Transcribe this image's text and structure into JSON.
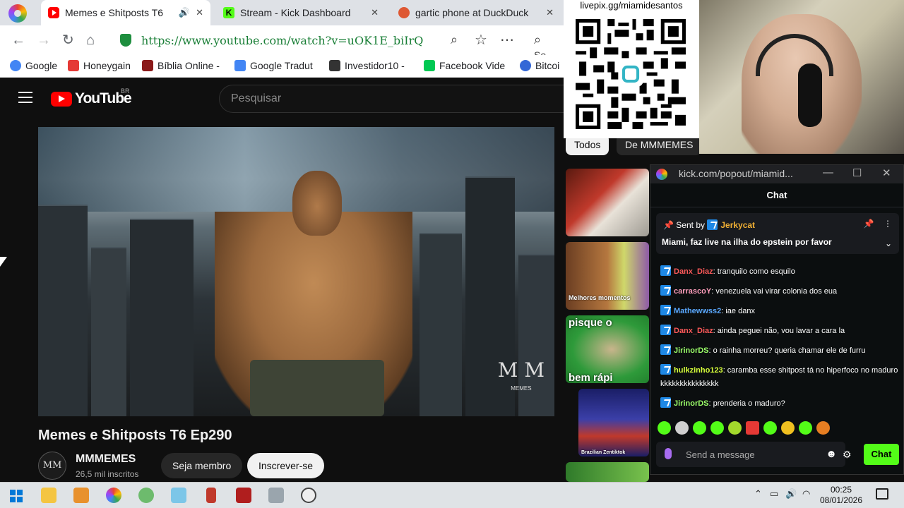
{
  "browser": {
    "tabs": [
      {
        "title": "Memes e Shitposts T6",
        "icon": "youtube-icon",
        "audio": true
      },
      {
        "title": "Stream - Kick Dashboard",
        "icon": "kick-icon"
      },
      {
        "title": "gartic phone at DuckDuck",
        "icon": "duckduckgo-icon"
      }
    ],
    "url": "https://www.youtube.com/watch?v=uOK1E_biIrQ",
    "search_partial": "Se",
    "bookmarks": [
      {
        "label": "Google",
        "color": "#4285f4"
      },
      {
        "label": "Honeygain",
        "color": "#e53935"
      },
      {
        "label": "Bíblia Online -",
        "color": "#8b1a1a"
      },
      {
        "label": "Google Tradut",
        "color": "#4285f4"
      },
      {
        "label": "Investidor10 -",
        "color": "#333333"
      },
      {
        "label": "Facebook Vide",
        "color": "#00c853"
      },
      {
        "label": "Bitcoi",
        "color": "#3367d6"
      }
    ]
  },
  "youtube": {
    "logo": "YouTube",
    "region": "BR",
    "search_placeholder": "Pesquisar",
    "video_title": "Memes e Shitposts T6 Ep290",
    "watermark": "M M",
    "watermark_small": "MEMES",
    "channel": {
      "avatar": "MM",
      "name": "MMMEMES",
      "subs": "26,5 mil inscritos"
    },
    "member_button": "Seja membro",
    "subscribe_button": "Inscrever-se",
    "filters": [
      "Todos",
      "De MMMEMES"
    ],
    "thumbnails": [
      {
        "label": ""
      },
      {
        "label": "Melhores momentos"
      },
      {
        "label": "pisque o",
        "label2": "bem rápi"
      },
      {
        "label": "Brazilian Zentiktok"
      }
    ]
  },
  "overlay": {
    "qr_url": "livepix.gg/miamidesantos"
  },
  "chat_window": {
    "url": "kick.com/popout/miamid...",
    "header": "Chat",
    "pinned": {
      "sent_by_label": "Sent by",
      "user": "Jerkycat",
      "message": "Miami, faz live na ilha do epstein por favor"
    },
    "messages": [
      {
        "user": "Danx_Diaz",
        "color": "#ff5a5a",
        "text": ": tranquilo como esquilo"
      },
      {
        "user": "carrascoY",
        "color": "#ff9ebc",
        "text": ": venezuela vai virar colonia dos eua"
      },
      {
        "user": "Mathewwss2",
        "color": "#5aa8ff",
        "text": ": iae danx"
      },
      {
        "user": "Danx_Diaz",
        "color": "#ff5a5a",
        "text": ": ainda peguei não, vou lavar a cara la"
      },
      {
        "user": "JirinorDS",
        "color": "#9cff6a",
        "text": ": o rainha morreu? queria chamar ele de furru"
      },
      {
        "user": "hulkzinho123",
        "color": "#d7ff3a",
        "text": ": caramba esse shitpost tá no hiperfoco no maduro kkkkkkkkkkkkkkk"
      },
      {
        "user": "JirinorDS",
        "color": "#9cff6a",
        "text": ": prenderia o maduro?"
      }
    ],
    "input_placeholder": "Send a message",
    "send_button": "Chat",
    "accent": "#53fc18"
  },
  "taskbar": {
    "time": "00:25",
    "date": "08/01/2026"
  }
}
